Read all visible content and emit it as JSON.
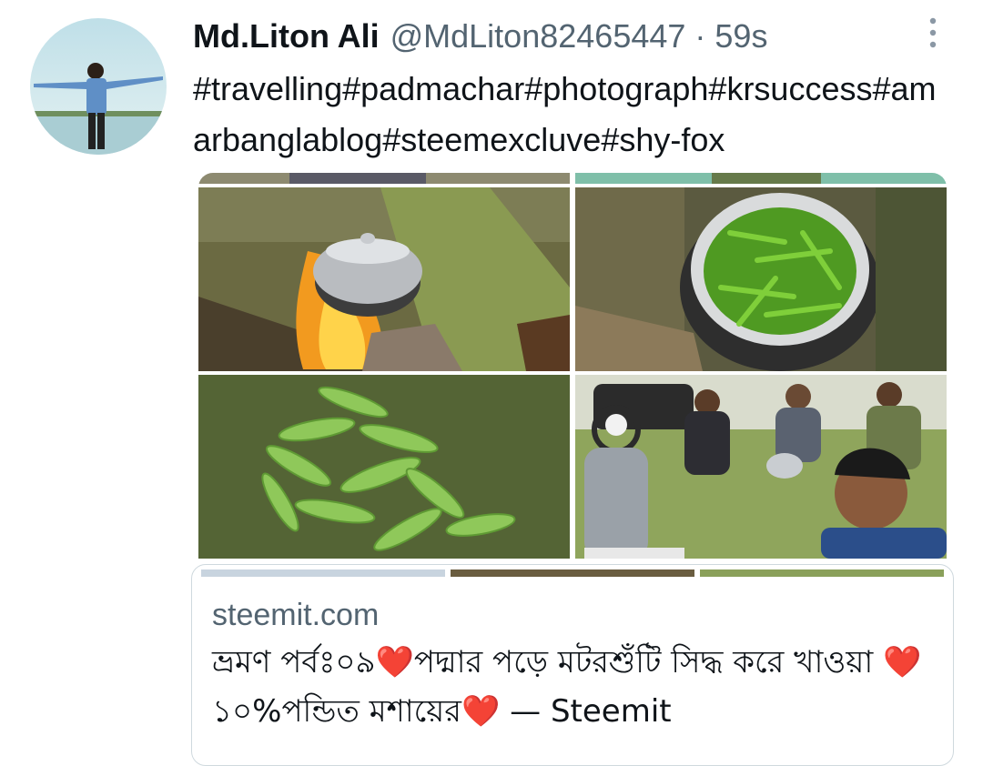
{
  "tweet": {
    "author": {
      "display_name": "Md.Liton Ali",
      "handle": "@MdLiton82465447",
      "separator": "·",
      "time": "59s"
    },
    "text": "#travelling#padmachar#photograph#krsuccess#amarbanglablog#steemexcluve#shy-fox",
    "hashtags": [
      "#travelling",
      "#padmachar",
      "#photograph",
      "#krsuccess",
      "#amarbanglablog",
      "#steemexcluve",
      "#shy-fox"
    ],
    "more_icon": "vertical-ellipsis-icon"
  },
  "media": {
    "photos": [
      "cooking-pot-on-fire",
      "green-chilies-in-pot",
      "green-peas-on-grass",
      "group-selfie-outdoors"
    ]
  },
  "link_card": {
    "domain": "steemit.com",
    "title": "ভ্রমণ পর্বঃ০৯❤️পদ্মার পড়ে মটরশুঁটি সিদ্ধ করে খাওয়া ❤️১০%পন্ডিত মশায়ের❤️ — Steemit"
  },
  "colors": {
    "link": "#0f1419",
    "secondary_text": "#536471",
    "border": "#cfd9de"
  }
}
